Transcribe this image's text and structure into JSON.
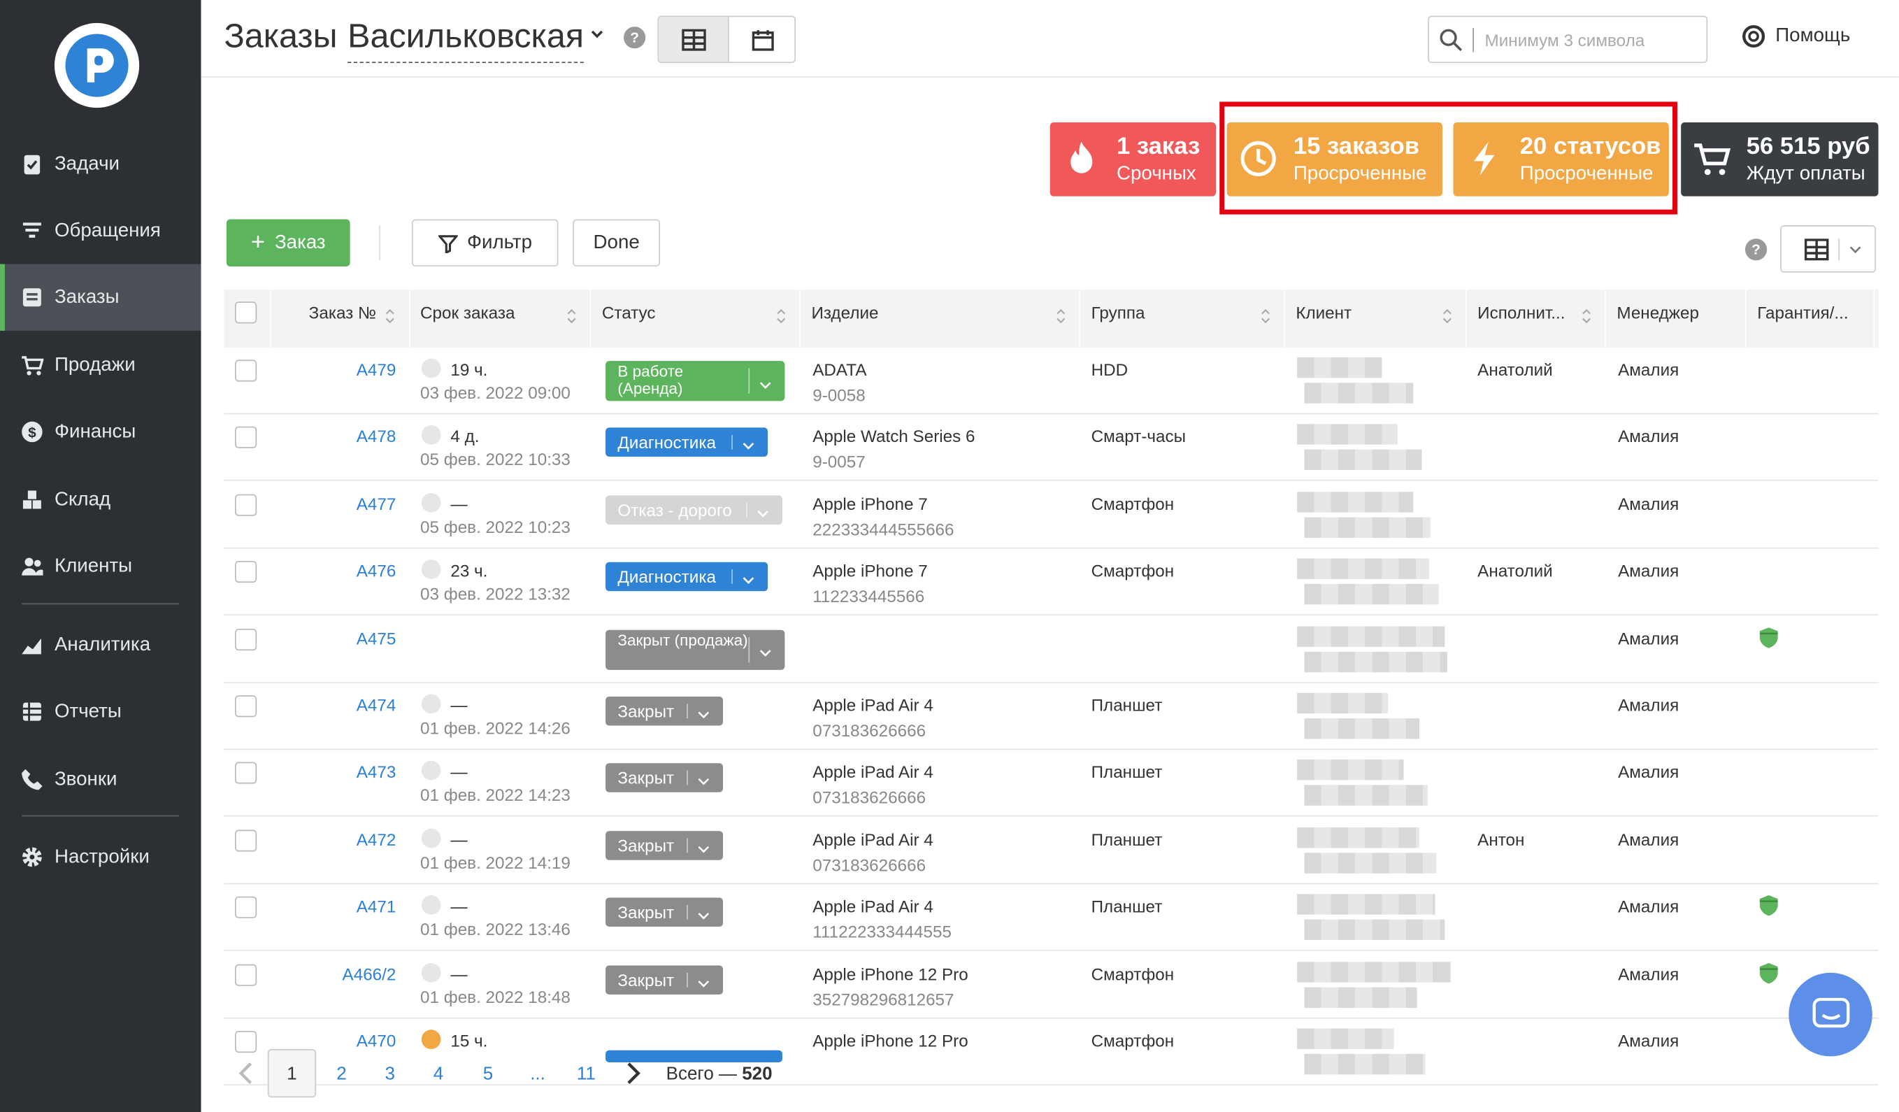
{
  "sidebar": {
    "items": [
      {
        "label": "Задачи",
        "icon": "tasks-icon"
      },
      {
        "label": "Обращения",
        "icon": "inquiries-icon"
      },
      {
        "label": "Заказы",
        "icon": "orders-icon",
        "active": true
      },
      {
        "label": "Продажи",
        "icon": "cart-icon"
      },
      {
        "label": "Финансы",
        "icon": "dollar-icon"
      },
      {
        "label": "Склад",
        "icon": "warehouse-icon"
      },
      {
        "label": "Клиенты",
        "icon": "clients-icon"
      },
      {
        "label": "Аналитика",
        "icon": "analytics-icon"
      },
      {
        "label": "Отчеты",
        "icon": "reports-icon"
      },
      {
        "label": "Звонки",
        "icon": "phone-icon"
      },
      {
        "label": "Настройки",
        "icon": "gear-icon"
      }
    ]
  },
  "header": {
    "title": "Заказы",
    "branch": "Васильковская",
    "help": "?",
    "search_placeholder": "Минимум 3 символа",
    "help_label": "Помощь"
  },
  "stats": [
    {
      "value": "1 заказ",
      "label": "Срочных",
      "color": "#f0585a",
      "icon": "flame-icon"
    },
    {
      "value": "15 заказов",
      "label": "Просроченные",
      "color": "#f2a644",
      "icon": "clock-icon"
    },
    {
      "value": "20 статусов",
      "label": "Просроченные",
      "color": "#f2a644",
      "icon": "lightning-icon"
    },
    {
      "value": "56 515 руб",
      "label": "Ждут оплаты",
      "color": "#3a3e42",
      "icon": "cart-icon"
    }
  ],
  "toolbar": {
    "add_label": "Заказ",
    "filter_label": "Фильтр",
    "done_label": "Done",
    "help": "?"
  },
  "table": {
    "columns": [
      "Заказ №",
      "Срок заказа",
      "Статус",
      "Изделие",
      "Группа",
      "Клиент",
      "Исполнит...",
      "Менеджер",
      "Гарантия/..."
    ],
    "rows": [
      {
        "id": "A479",
        "deadline": "19 ч.",
        "date": "03 фев. 2022 09:00",
        "status": "В работе (Аренда)",
        "status_color": "#5cb45d",
        "product": "ADATA",
        "serial": "9-0058",
        "group": "HDD",
        "executor": "Анатолий",
        "manager": "Амалия",
        "warranty": false
      },
      {
        "id": "A478",
        "deadline": "4 д.",
        "date": "05 фев. 2022 10:33",
        "status": "Диагностика",
        "status_color": "#2f83d6",
        "product": "Apple Watch Series 6",
        "serial": "9-0057",
        "group": "Смарт-часы",
        "executor": "",
        "manager": "Амалия",
        "warranty": false
      },
      {
        "id": "A477",
        "deadline": "—",
        "date": "05 фев. 2022 10:23",
        "status": "Отказ - дорого",
        "status_color": "#d5d5d5",
        "product": "Apple iPhone 7",
        "serial": "222333444555666",
        "group": "Смартфон",
        "executor": "",
        "manager": "Амалия",
        "warranty": false
      },
      {
        "id": "A476",
        "deadline": "23 ч.",
        "date": "03 фев. 2022 13:32",
        "status": "Диагностика",
        "status_color": "#2f83d6",
        "product": "Apple iPhone 7",
        "serial": "112233445566",
        "group": "Смартфон",
        "executor": "Анатолий",
        "manager": "Амалия",
        "warranty": false
      },
      {
        "id": "A475",
        "deadline": "",
        "date": "",
        "status": "Закрыт (продажа)",
        "status_color": "#8c8c8c",
        "product": "",
        "serial": "",
        "group": "",
        "executor": "",
        "manager": "Амалия",
        "warranty": true
      },
      {
        "id": "A474",
        "deadline": "—",
        "date": "01 фев. 2022 14:26",
        "status": "Закрыт",
        "status_color": "#8c8c8c",
        "product": "Apple iPad Air 4",
        "serial": "073183626666",
        "group": "Планшет",
        "executor": "",
        "manager": "Амалия",
        "warranty": false
      },
      {
        "id": "A473",
        "deadline": "—",
        "date": "01 фев. 2022 14:23",
        "status": "Закрыт",
        "status_color": "#8c8c8c",
        "product": "Apple iPad Air 4",
        "serial": "073183626666",
        "group": "Планшет",
        "executor": "",
        "manager": "Амалия",
        "warranty": false
      },
      {
        "id": "A472",
        "deadline": "—",
        "date": "01 фев. 2022 14:19",
        "status": "Закрыт",
        "status_color": "#8c8c8c",
        "product": "Apple iPad Air 4",
        "serial": "073183626666",
        "group": "Планшет",
        "executor": "Антон",
        "manager": "Амалия",
        "warranty": false
      },
      {
        "id": "A471",
        "deadline": "—",
        "date": "01 фев. 2022 13:46",
        "status": "Закрыт",
        "status_color": "#8c8c8c",
        "product": "Apple iPad Air 4",
        "serial": "111222333444555",
        "group": "Планшет",
        "executor": "",
        "manager": "Амалия",
        "warranty": true
      },
      {
        "id": "A466/2",
        "deadline": "—",
        "date": "01 фев. 2022 18:48",
        "status": "Закрыт",
        "status_color": "#8c8c8c",
        "product": "Apple iPhone 12 Pro",
        "serial": "352798296812657",
        "group": "Смартфон",
        "executor": "",
        "manager": "Амалия",
        "warranty": true
      },
      {
        "id": "A470",
        "deadline": "15 ч.",
        "date": "",
        "status": "",
        "status_color": "#2f83d6",
        "product": "Apple iPhone 12 Pro",
        "serial": "",
        "group": "Смартфон",
        "executor": "",
        "manager": "Амалия",
        "warranty": false
      }
    ]
  },
  "pagination": {
    "pages": [
      "1",
      "2",
      "3",
      "4",
      "5",
      "...",
      "11"
    ],
    "current": "1",
    "total_label": "Всего — ",
    "total": "520"
  }
}
